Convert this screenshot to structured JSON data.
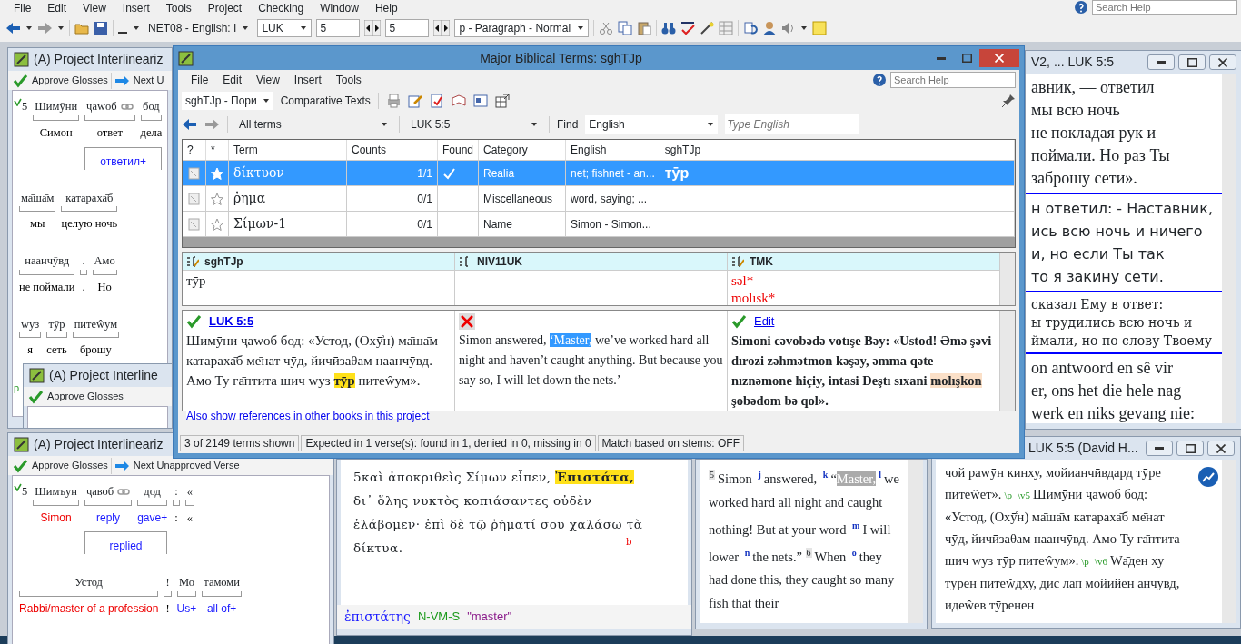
{
  "menu_bar": [
    "File",
    "Edit",
    "View",
    "Insert",
    "Tools",
    "Project",
    "Checking",
    "Window",
    "Help"
  ],
  "toolbar": {
    "resource": "NET08  - English: I",
    "book": "LUK",
    "chapter": "5",
    "verse": "5",
    "style": "p - Paragraph - Normal",
    "search_placeholder": "Search Help"
  },
  "interlinear_top": {
    "title": "(A) Project Interlineariz",
    "approve": "Approve Glosses",
    "next": "Next U",
    "marker": "p",
    "rows": [
      {
        "verse": "5",
        "groups": [
          {
            "words": [
              {
                "source": "Шимӯни",
                "gloss": "Симон",
                "kind": "confirmed",
                "linked": false
              }
            ]
          },
          {
            "words": [
              {
                "source": "ҷawоб",
                "gloss": "ответ",
                "kind": "confirmed",
                "linked": true
              },
              {
                "source": "бод",
                "gloss": "дела",
                "kind": "confirmed",
                "linked": false
              }
            ],
            "phrase": "ответил+"
          }
        ]
      },
      {
        "groups": [
          {
            "words": [
              {
                "source": "ма̄ша̄м",
                "gloss": "мы",
                "kind": "confirmed",
                "linked": false
              },
              {
                "source": "катараха̄б",
                "gloss": "целую ночь",
                "kind": "confirmed",
                "linked": false
              }
            ]
          }
        ]
      },
      {
        "groups": [
          {
            "words": [
              {
                "source": "наанчӯвд",
                "gloss": "не поймали",
                "kind": "confirmed",
                "linked": false
              },
              {
                "source": ".",
                "gloss": ".",
                "kind": "confirmed",
                "linked": false
              },
              {
                "source": "Амо",
                "gloss": "Но",
                "kind": "confirmed",
                "linked": false
              }
            ]
          }
        ]
      },
      {
        "groups": [
          {
            "words": [
              {
                "source": "wуз",
                "gloss": "я",
                "kind": "confirmed",
                "linked": false
              },
              {
                "source": "тӯр",
                "gloss": "сеть",
                "kind": "confirmed",
                "linked": false
              },
              {
                "source": "питеŵум",
                "gloss": "брошу",
                "kind": "confirmed",
                "linked": false
              }
            ]
          }
        ]
      }
    ]
  },
  "interlinear_nested": {
    "title": "(A) Project Interline",
    "approve": "Approve Glosses"
  },
  "interlinear_bottom": {
    "title": "(A) Project Interlineariz",
    "approve": "Approve Glosses",
    "next": "Next Unapproved Verse",
    "rows": [
      {
        "verse": "5",
        "groups": [
          {
            "words": [
              {
                "source": "Шимъун",
                "gloss": "Simon",
                "kind": "missing",
                "linked": false
              }
            ]
          },
          {
            "words": [
              {
                "source": "ҷавоб",
                "gloss": "reply",
                "kind": "suggested",
                "linked": true
              },
              {
                "source": "дод",
                "gloss": "gave+",
                "kind": "suggested",
                "linked": false
              }
            ],
            "phrase": "replied"
          },
          {
            "words": [
              {
                "source": ":",
                "gloss": ":",
                "kind": "confirmed",
                "linked": false
              },
              {
                "source": "«",
                "gloss": "«",
                "kind": "confirmed",
                "linked": false
              }
            ]
          }
        ]
      },
      {
        "groups": [
          {
            "words": [
              {
                "source": "Устод",
                "gloss": "Rabbi/master of a profession",
                "kind": "missing",
                "linked": false
              },
              {
                "source": "!",
                "gloss": "!",
                "kind": "confirmed",
                "linked": false
              },
              {
                "source": "Мо",
                "gloss": "Us+",
                "kind": "suggested",
                "linked": false
              },
              {
                "source": "тамоми",
                "gloss": "all of+",
                "kind": "suggested",
                "linked": false
              }
            ]
          }
        ]
      }
    ]
  },
  "dialog": {
    "title": "Major Biblical Terms: sghTJp",
    "menu": [
      "File",
      "Edit",
      "View",
      "Insert",
      "Tools"
    ],
    "search_placeholder": "Search Help",
    "project": "sghTJp - Пори",
    "comparative": "Comparative Texts",
    "filter": "All terms",
    "reference": "LUK 5:5",
    "find_label": "Find",
    "find_language": "English",
    "find_placeholder": "Type English",
    "table": {
      "columns": [
        "?",
        "*",
        "Term",
        "Counts",
        "Found",
        "Category",
        "English",
        "sghTJp"
      ],
      "rows": [
        {
          "selected": true,
          "starred": true,
          "term": "δίκτυον",
          "counts": "1/1",
          "found": true,
          "category": "Realia",
          "english": "net; fishnet - an...",
          "rendering": "тӯр"
        },
        {
          "selected": false,
          "starred": false,
          "term": "ῥῆμα",
          "counts": "0/1",
          "found": false,
          "category": "Miscellaneous",
          "english": "word, saying; ..."
        },
        {
          "selected": false,
          "starred": false,
          "term": "Σίμων-1",
          "counts": "0/1",
          "found": false,
          "category": "Name",
          "english": "Simon - Simon..."
        }
      ]
    },
    "renderings": [
      {
        "project": "sghTJp",
        "editable": true,
        "values": [
          "тӯр"
        ]
      },
      {
        "project": "NIV11UK",
        "editable": false
      },
      {
        "project": "TMK",
        "editable": true,
        "values": [
          "səl*",
          "molısk*"
        ]
      }
    ],
    "verses": [
      {
        "found": true,
        "link": "LUK 5:5",
        "segments": [
          {
            "text": "Шимӯни ҷawоб бод: «Устод, (Охӯ̊н) ма̄ша̄м катараха̄б ме̄нат чӯд, йичӣзаθам наанчӯвд. Амо Ту га̄птита шич wуз ",
            "kind": "plain"
          },
          {
            "text": "тӯр",
            "kind": "found"
          },
          {
            "text": " питеŵум».",
            "kind": "plain"
          }
        ]
      },
      {
        "found": false,
        "segments": [
          {
            "text": "Simon answered, ",
            "kind": "plain"
          },
          {
            "text": "‘Master,",
            "kind": "selected"
          },
          {
            "text": " we’ve worked hard all night and haven’t caught anything. But because you say so, I will let down the nets.’",
            "kind": "plain"
          }
        ]
      },
      {
        "found": true,
        "link": "Edit",
        "segments": [
          {
            "text": "Simoni cəvobədə votışe Bəy: «Ustod! Əmə şəvi dırozi zəhmətmon kəşəy, əmma qəte nıznəmone hiçiy, intasi Deştı sıxani ",
            "kind": "plain"
          },
          {
            "text": "molışkon",
            "kind": "partial"
          },
          {
            "text": " şobədom bə qol».",
            "kind": "plain"
          }
        ]
      }
    ],
    "more_link": "Also show references in other books in this project",
    "status_bar": [
      "3 of 2149 terms shown",
      "Expected in 1 verse(s): found in 1, denied in 0, missing in 0",
      "Match based on stems: OFF"
    ]
  },
  "compare_window": {
    "title": "V2, ... LUK 5:5",
    "blocks": [
      [
        "авник, — ответил",
        "мы всю ночь",
        "не покладая рук и",
        "поймали. Но раз Ты",
        "заброшу сети»."
      ],
      [
        "н ответил: - Наставник,",
        "ись всю ночь и ничего",
        "и, но если Ты так",
        "то я закину сети."
      ],
      [
        "сказал Ему в ответ:",
        "ы трудились всю ночь и",
        "ймали, но по слову Твоему"
      ],
      [
        "on antwoord en sê vir",
        "er, ons het die hele nag",
        "werk en niks gevang nie:"
      ]
    ]
  },
  "greek_window": {
    "verse": "5",
    "segments": [
      {
        "text": "καὶ ἀποκριθεὶς Σίμων εἶπεν, ",
        "kind": "plain"
      },
      {
        "text": "Ἐπιστάτα,",
        "kind": "found"
      },
      {
        "text": " δι᾽ ὅλης νυκτὸς κοπιάσαντες οὐδὲν ἐλάβομεν· ἐπὶ δὲ τῷ ῥήματί σου χαλάσω τὰ δίκτυα.",
        "kind": "plain"
      }
    ],
    "footnote": "b",
    "lemma": "ἐπιστάτης",
    "parsing": "N-VM-S",
    "gloss": "\"master\""
  },
  "english_window": {
    "segments": [
      {
        "text": "5",
        "kind": "verse"
      },
      {
        "text": "Simon ",
        "kind": "plain"
      },
      {
        "text": "j",
        "kind": "note"
      },
      {
        "text": "answered, ",
        "kind": "plain"
      },
      {
        "text": "k",
        "kind": "note"
      },
      {
        "text": "“",
        "kind": "plain"
      },
      {
        "text": "Master,",
        "kind": "inactive"
      },
      {
        "text": "l",
        "kind": "note"
      },
      {
        "text": "we worked hard all night and caught nothing! But at your word ",
        "kind": "plain"
      },
      {
        "text": "m",
        "kind": "note"
      },
      {
        "text": "I will lower ",
        "kind": "plain"
      },
      {
        "text": "n",
        "kind": "note"
      },
      {
        "text": "the nets.” ",
        "kind": "plain"
      },
      {
        "text": "6",
        "kind": "verse"
      },
      {
        "text": "When ",
        "kind": "plain"
      },
      {
        "text": "o",
        "kind": "note"
      },
      {
        "text": "they had done this, they caught so many fish that their",
        "kind": "plain"
      }
    ]
  },
  "source_window": {
    "title": "LUK 5:5 (David H...",
    "segments": [
      {
        "text": "чой раwӯн кинху, мойианчӣвдард тӯре питеŵет».",
        "kind": "plain"
      },
      {
        "text": "\\p",
        "kind": "marker"
      },
      {
        "text": "\\v5",
        "kind": "marker"
      },
      {
        "text": "Шимӯни ҷawоб бод: «Устод, (Охӯ̊н) ма̄ша̄м катараха̄б ме̄нат чӯд, йичӣзаθам наанчӯвд. Амо Ту га̄птита шич wуз тӯр питеŵум».",
        "kind": "plain"
      },
      {
        "text": "\\p",
        "kind": "marker"
      },
      {
        "text": "\\v6",
        "kind": "marker"
      },
      {
        "text": "Wа̄ден ху тӯрен питеŵдху, дис лап мойийен анчӯвд, идеŵев тӯренен",
        "kind": "plain"
      }
    ]
  }
}
